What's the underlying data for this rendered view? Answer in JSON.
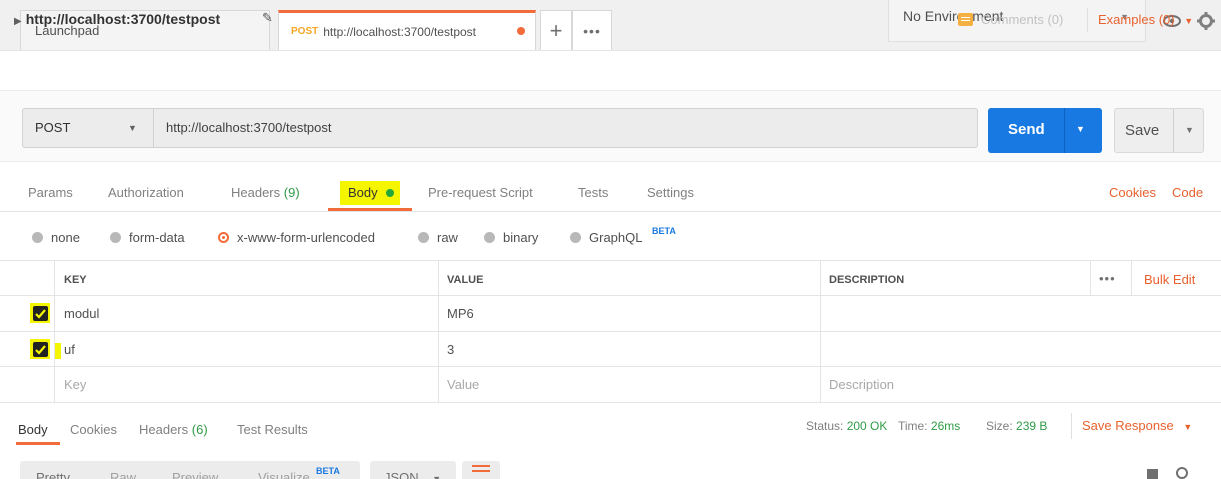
{
  "tabs": {
    "launchpad_label": "Launchpad",
    "active_method": "POST",
    "active_url": "http://localhost:3700/testpost",
    "new_tab_symbol": "+",
    "more_symbol": "•••"
  },
  "environment": {
    "selected": "No Environment"
  },
  "request": {
    "name": "http://localhost:3700/testpost",
    "comments_label": "Comments (0)",
    "examples_label": "Examples (0)",
    "method": "POST",
    "url": "http://localhost:3700/testpost",
    "send_label": "Send",
    "save_label": "Save"
  },
  "request_tabs": {
    "params": "Params",
    "authorization": "Authorization",
    "headers": "Headers",
    "headers_count": "(9)",
    "body": "Body",
    "prerequest": "Pre-request Script",
    "tests": "Tests",
    "settings": "Settings",
    "cookies": "Cookies",
    "code": "Code"
  },
  "body_modes": {
    "none": "none",
    "form_data": "form-data",
    "urlencoded": "x-www-form-urlencoded",
    "raw": "raw",
    "binary": "binary",
    "graphql": "GraphQL",
    "beta": "BETA",
    "selected": "x-www-form-urlencoded"
  },
  "params_table": {
    "headers": {
      "key": "KEY",
      "value": "VALUE",
      "description": "DESCRIPTION"
    },
    "more": "•••",
    "bulk_edit": "Bulk Edit",
    "rows": [
      {
        "key": "modul",
        "value": "MP6",
        "description": "",
        "checked": true
      },
      {
        "key": "uf",
        "value": "3",
        "description": "",
        "checked": true
      }
    ],
    "placeholders": {
      "key": "Key",
      "value": "Value",
      "description": "Description"
    }
  },
  "response": {
    "tabs": {
      "body": "Body",
      "cookies": "Cookies",
      "headers": "Headers",
      "headers_count": "(6)",
      "test_results": "Test Results"
    },
    "status_label": "Status:",
    "status_value": "200 OK",
    "time_label": "Time:",
    "time_value": "26ms",
    "size_label": "Size:",
    "size_value": "239 B",
    "save_response": "Save Response",
    "views": {
      "pretty": "Pretty",
      "raw": "Raw",
      "preview": "Preview",
      "visualize": "Visualize",
      "visualize_beta": "BETA"
    },
    "format": "JSON"
  },
  "colors": {
    "accent": "#f26b3a",
    "send_blue": "#1879e2",
    "status_green": "#2e9b45",
    "highlight_yellow": "#f5f500"
  }
}
